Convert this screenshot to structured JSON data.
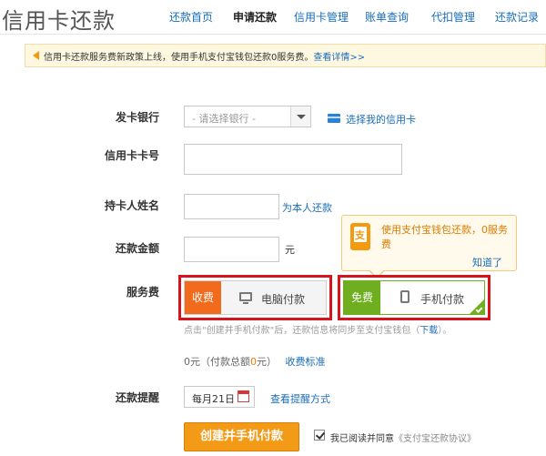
{
  "header": {
    "title": "信用卡还款",
    "nav": [
      {
        "label": "还款首页",
        "active": false
      },
      {
        "label": "申请还款",
        "active": true
      },
      {
        "label": "信用卡管理",
        "active": false
      },
      {
        "label": "账单查询",
        "active": false
      },
      {
        "label": "代扣管理",
        "active": false
      },
      {
        "label": "还款记录",
        "active": false
      }
    ]
  },
  "notice": {
    "text": "信用卡还款服务费新政策上线，使用手机支付宝钱包还款0服务费。",
    "link": "查看详情>>"
  },
  "form": {
    "bank_label": "发卡银行",
    "bank_placeholder": "- 请选择银行 -",
    "my_cards_link": "选择我的信用卡",
    "card_no_label": "信用卡卡号",
    "holder_label": "持卡人姓名",
    "self_repay_link": "为本人还款",
    "amount_label": "还款金额",
    "amount_unit": "元",
    "fee_label": "服务费",
    "remind_label": "还款提醒",
    "remind_date": "每月21日",
    "remind_link": "查看提醒方式"
  },
  "payment": {
    "pc": {
      "tag": "收费",
      "label": "电脑付款"
    },
    "mobile": {
      "tag": "免费",
      "label": "手机付款"
    }
  },
  "tooltip": {
    "text": "使用支付宝钱包还款，0服务费",
    "link": "知道了"
  },
  "hint": {
    "text": "点击\"创建并手机付款\"后，还款信息将同步至支付宝钱包（",
    "link": "下载",
    "suffix": "）。"
  },
  "total": {
    "amount": "0",
    "unit": "元（付款总额",
    "total_amount": "0",
    "total_unit": "元）",
    "link": "收费标准"
  },
  "submit_label": "创建并手机付款",
  "agreement": {
    "text": "我已阅读并同意",
    "link": "《支付宝还款协议》"
  },
  "colors": {
    "accent_orange": "#f39a17",
    "fee_orange": "#f26b1d",
    "free_green": "#6fae1e",
    "highlight_red": "#d7141b",
    "link_blue": "#1a6dba"
  },
  "icons": {
    "notice": "speaker-icon",
    "card": "credit-card-icon",
    "pc": "computer-icon",
    "mobile": "phone-icon",
    "calendar": "calendar-icon",
    "wallet": "alipay-wallet-icon"
  }
}
